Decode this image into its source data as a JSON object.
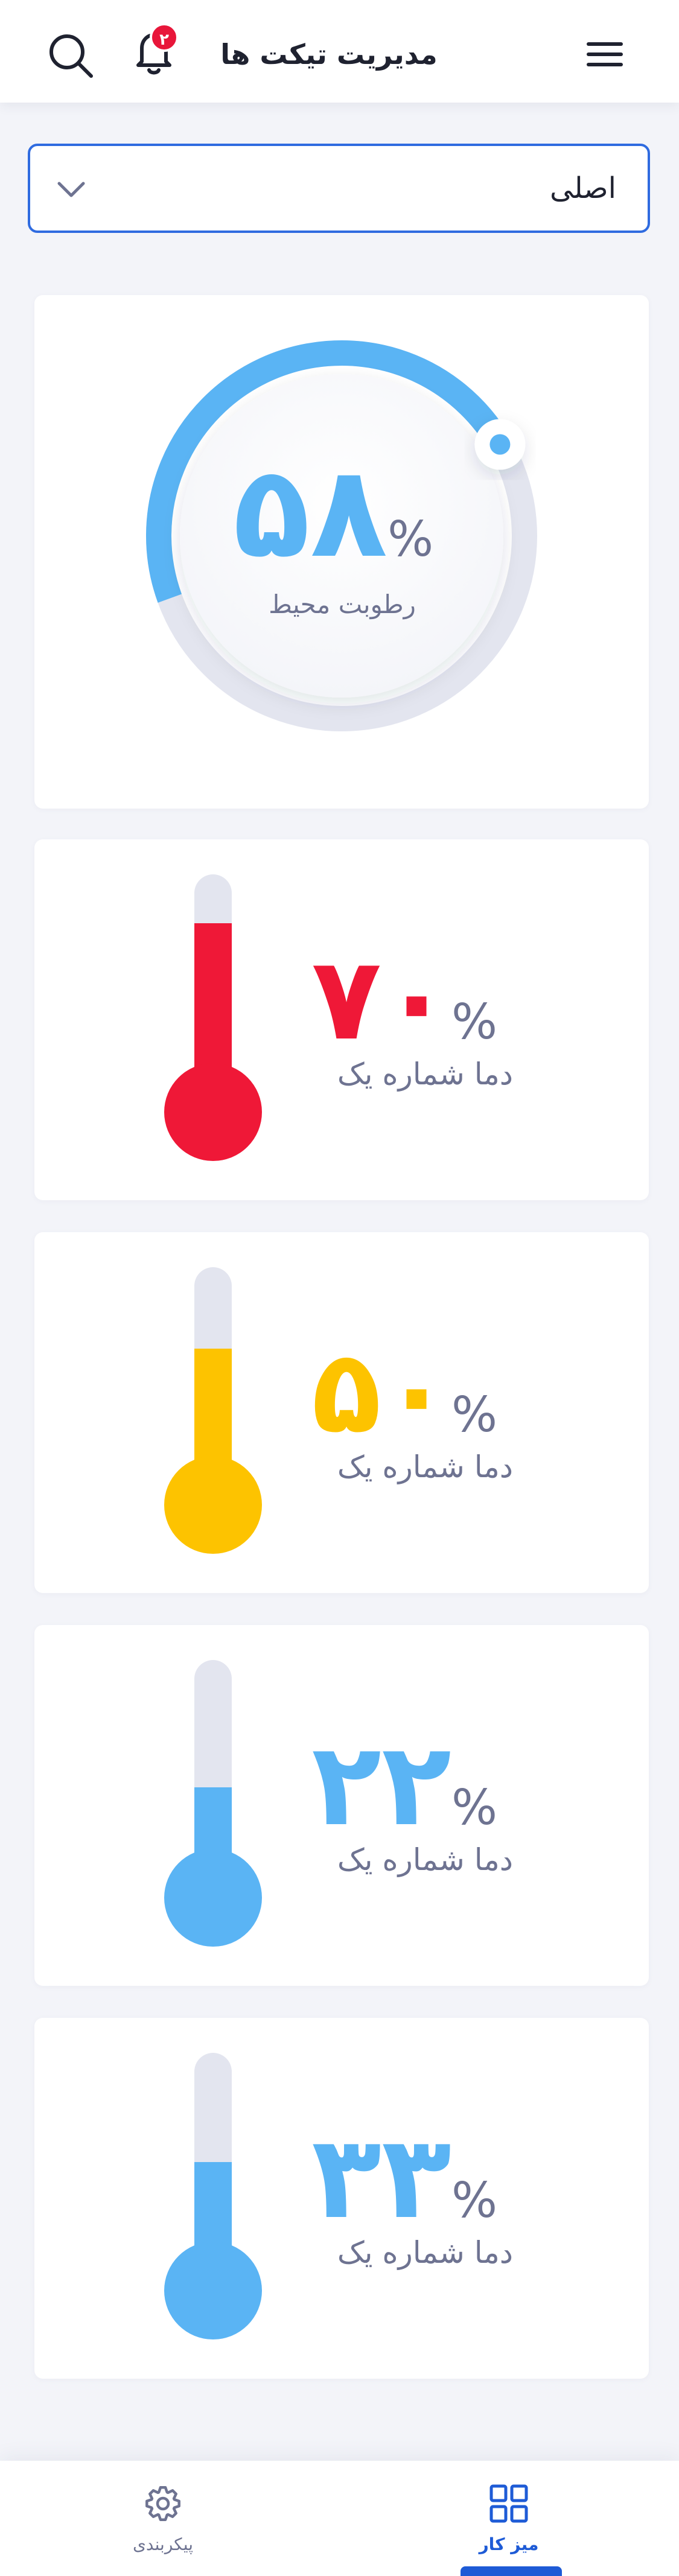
{
  "header": {
    "title": "مدیریت تیکت ها",
    "notification_count": "۲",
    "icons": [
      "menu-icon",
      "bell-icon",
      "search-icon"
    ]
  },
  "selector": {
    "value": "اصلی"
  },
  "humidity": {
    "value": "۵۸",
    "unit": "%",
    "label": "رطوبت محیط",
    "level": 0.58,
    "color": "#5ab4f4"
  },
  "temperatures": [
    {
      "value": "۷۰",
      "unit": "%",
      "label": "دما شماره یک",
      "level": 0.7,
      "color": "#ef1837"
    },
    {
      "value": "۵۰",
      "unit": "%",
      "label": "دما شماره یک",
      "level": 0.5,
      "color": "#fdc300"
    },
    {
      "value": "۲۲",
      "unit": "%",
      "label": "دما شماره یک",
      "level": 0.22,
      "color": "#5ab4f4"
    },
    {
      "value": "۳۳",
      "unit": "%",
      "label": "دما شماره یک",
      "level": 0.33,
      "color": "#5ab4f4"
    }
  ],
  "bottom_nav": {
    "dashboard_label": "میز کار",
    "settings_label": "پیکربندی",
    "active": "dashboard"
  },
  "colors": {
    "accent": "#1e5bd6",
    "text_muted": "#6e7391",
    "track": "#e3e5ef"
  }
}
